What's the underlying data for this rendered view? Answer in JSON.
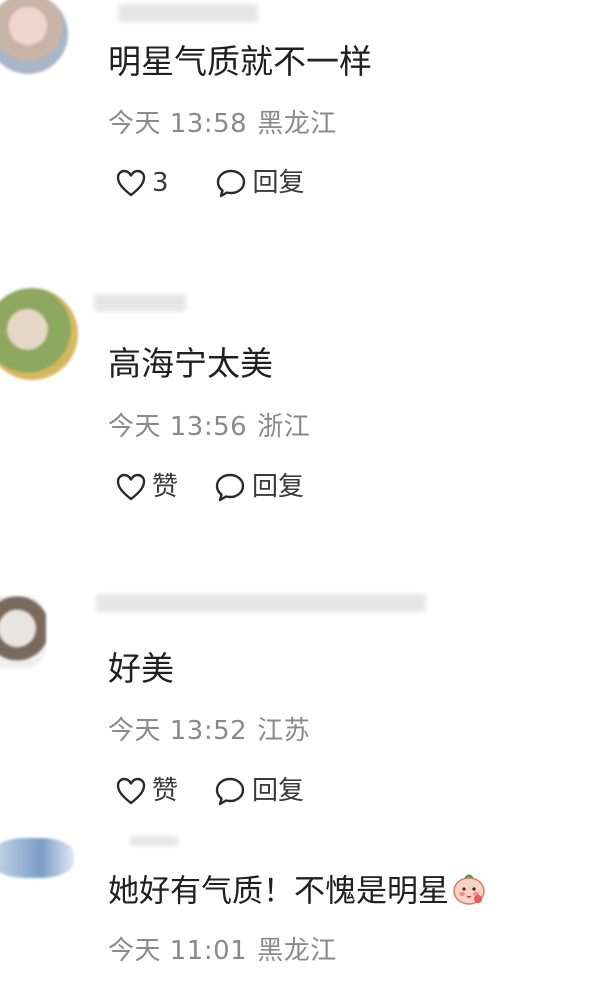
{
  "comments": [
    {
      "text": "明星气质就不一样",
      "time": "今天 13:58",
      "location": "黑龙江",
      "like_label": "3",
      "reply_label": "回复"
    },
    {
      "text": "高海宁太美",
      "time": "今天 13:56",
      "location": "浙江",
      "like_label": "赞",
      "reply_label": "回复"
    },
    {
      "text": "好美",
      "time": "今天 13:52",
      "location": "江苏",
      "like_label": "赞",
      "reply_label": "回复"
    },
    {
      "text": "她好有气质！不愧是明星",
      "emoji_icon": "blushing-face-emoji",
      "time": "今天 11:01",
      "location": "黑龙江"
    }
  ],
  "icons": {
    "like": "heart-outline-icon",
    "reply": "speech-bubble-icon"
  },
  "colors": {
    "background": "#ffffff",
    "text": "#202020",
    "meta": "#8a8a8a"
  }
}
